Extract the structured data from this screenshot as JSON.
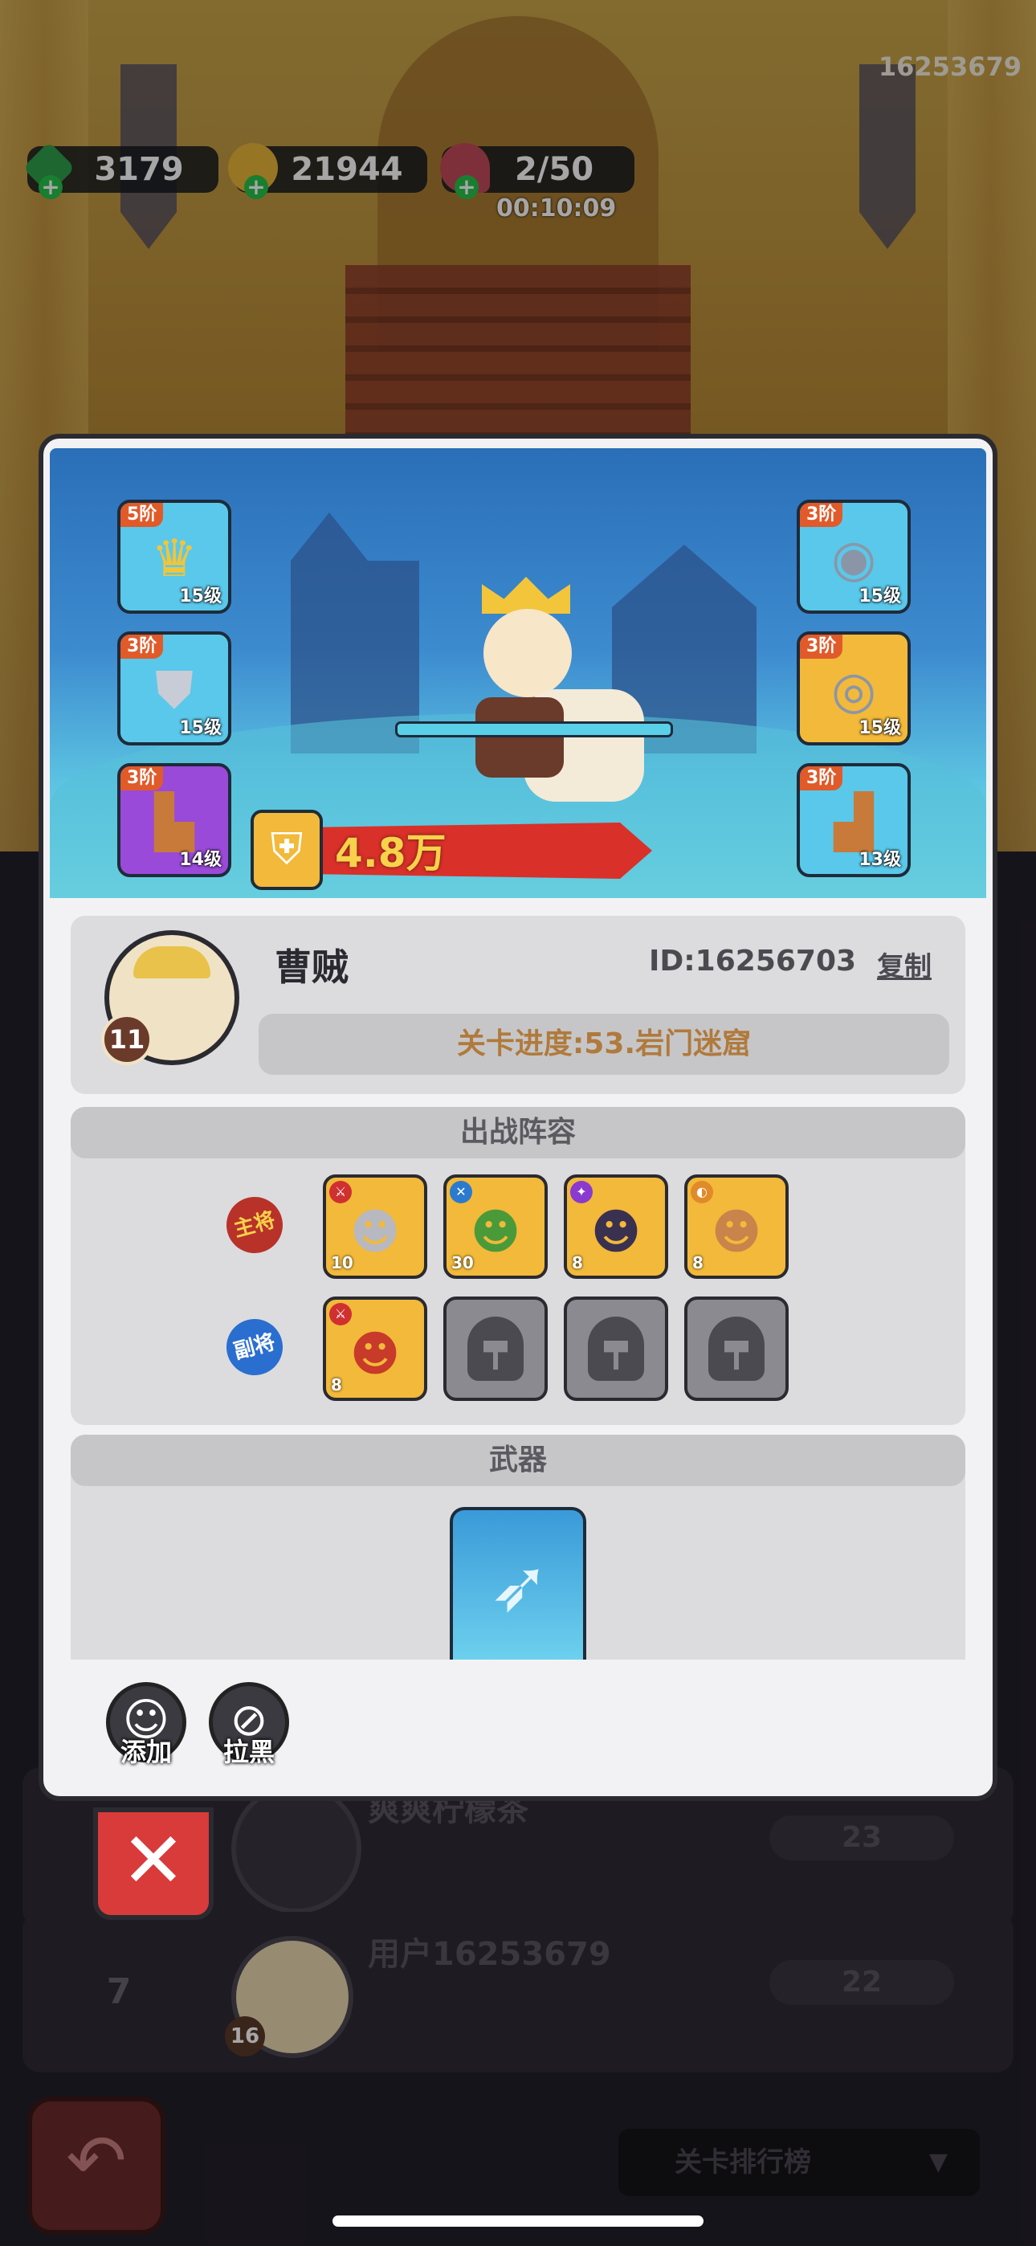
{
  "top_bar": {
    "user_id": "16253679",
    "gems": "3179",
    "gold": "21944",
    "stamina": "2/50",
    "stamina_timer": "00:10:09"
  },
  "player": {
    "name": "曹贼",
    "id_text": "ID:16256703",
    "copy_label": "复制",
    "level": "11",
    "power": "4.8万",
    "progress": "关卡进度:53.岩门迷窟"
  },
  "equipment": [
    {
      "tier": "5阶",
      "level": "15级",
      "icon": "crown-icon"
    },
    {
      "tier": "3阶",
      "level": "15级",
      "icon": "armor-icon"
    },
    {
      "tier": "3阶",
      "level": "14级",
      "icon": "pants-icon"
    },
    {
      "tier": "3阶",
      "level": "15级",
      "icon": "ring-icon"
    },
    {
      "tier": "3阶",
      "level": "15级",
      "icon": "ring-icon"
    },
    {
      "tier": "3阶",
      "level": "13级",
      "icon": "boots-icon"
    }
  ],
  "lineup": {
    "title": "出战阵容",
    "main_label": "主将",
    "sub_label": "副将",
    "main": [
      {
        "level": "10"
      },
      {
        "level": "30"
      },
      {
        "level": "8"
      },
      {
        "level": "8"
      }
    ],
    "sub": [
      {
        "level": "8"
      }
    ]
  },
  "weapon": {
    "title": "武器"
  },
  "actions": {
    "add_label": "添加",
    "block_label": "拉黑"
  },
  "ranking": {
    "rows": [
      {
        "name": "爽爽柠檬茶",
        "score": "23",
        "rank": "",
        "level": ""
      },
      {
        "name": "用户16253679",
        "score": "22",
        "rank": "7",
        "level": "16"
      }
    ],
    "dropdown_label": "关卡排行榜"
  },
  "colors": {
    "accent_red": "#d93a3a",
    "power_red": "#d9302a",
    "gold_text": "#b07a3c",
    "tier_orange": "#e05a2a"
  }
}
